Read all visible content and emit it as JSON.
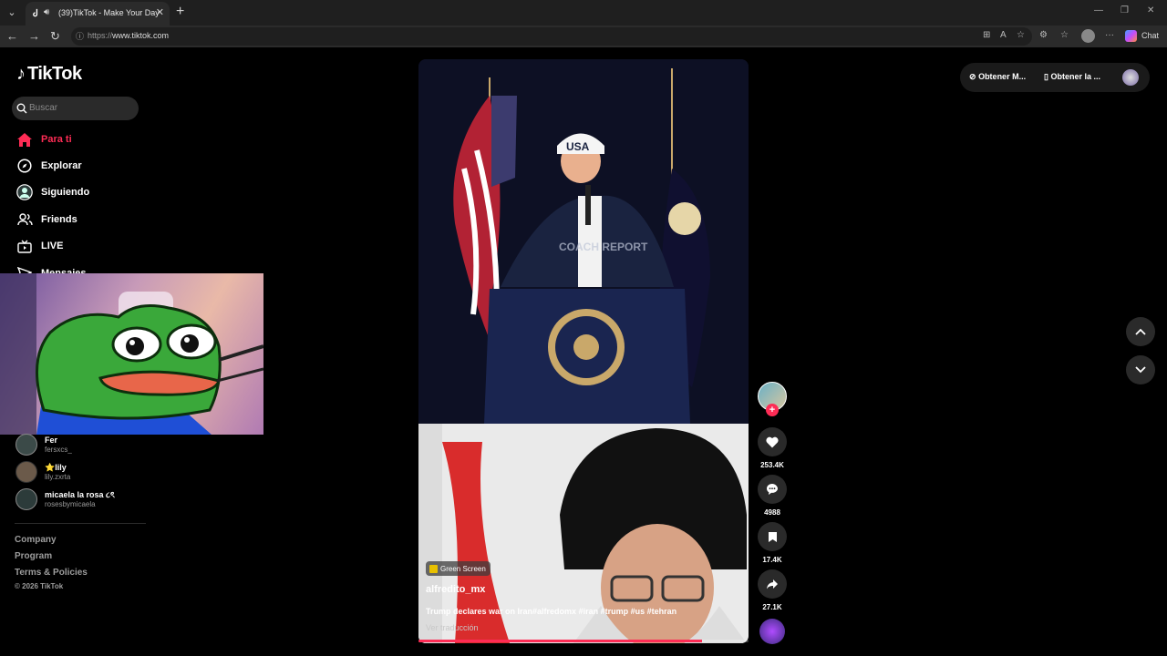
{
  "browser": {
    "tab_title": "(39)TikTok - Make Your Day",
    "url_prefix": "https://",
    "url_host": "www.tiktok.com",
    "chat_label": "Chat"
  },
  "sidebar": {
    "logo": "TikTok",
    "search_placeholder": "Buscar",
    "items": [
      {
        "label": "Para ti",
        "icon": "home-icon",
        "active": true
      },
      {
        "label": "Explorar",
        "icon": "compass-icon"
      },
      {
        "label": "Siguiendo",
        "icon": "following-avatar-icon"
      },
      {
        "label": "Friends",
        "icon": "friends-icon"
      },
      {
        "label": "LIVE",
        "icon": "live-tv-icon"
      },
      {
        "label": "Mensajes",
        "icon": "message-icon"
      }
    ],
    "following": [
      {
        "name": "Fer",
        "handle": "fersxcs_"
      },
      {
        "name": "⭐lily",
        "handle": "lily.zxrta"
      },
      {
        "name": "micaela la rosa ૮ৎ",
        "handle": "rosesbymicaela"
      }
    ],
    "footer": {
      "company": "Company",
      "program": "Program",
      "terms": "Terms & Policies",
      "copyright": "© 2026 TikTok"
    }
  },
  "topright": {
    "btn1": "Obtener M...",
    "btn2": "Obtener la ..."
  },
  "video": {
    "overlay_text": "COACH REPORT",
    "effect_badge": "Green Screen",
    "author": "alfredito_mx",
    "caption": "Trump declares war on Iran#alfredomx #iran #trump #us #tehran",
    "translate": "Ver traducción",
    "progress": 0.86
  },
  "actions": {
    "likes": "253.4K",
    "comments": "4988",
    "saves": "17.4K",
    "shares": "27.1K"
  },
  "colors": {
    "accent": "#fe2c55",
    "background": "#000000"
  }
}
